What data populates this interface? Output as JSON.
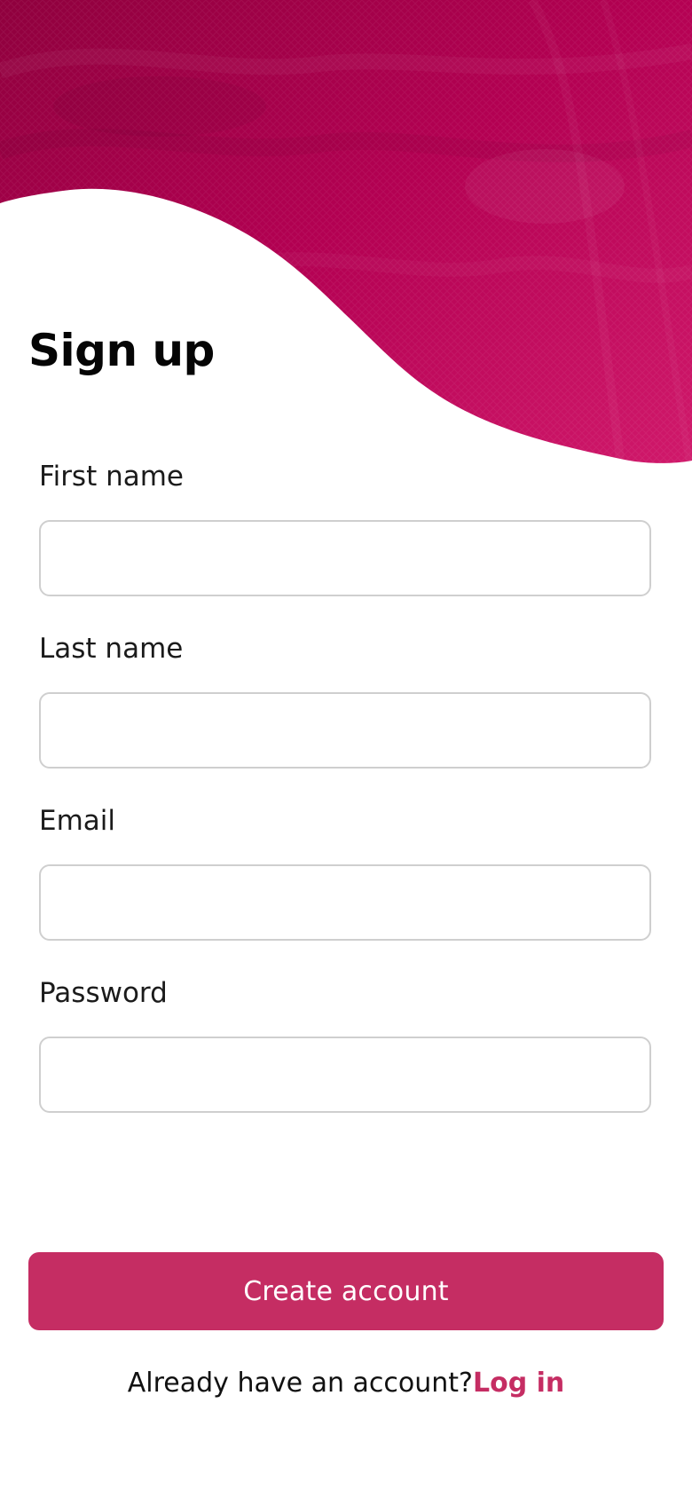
{
  "header": {
    "image": "crimson-fabric-texture-with-wave-edge",
    "colors": {
      "base": "#b30052",
      "dark": "#8f003d",
      "light": "#d1196b"
    }
  },
  "title": "Sign up",
  "fields": [
    {
      "label": "First name",
      "value": "",
      "placeholder": ""
    },
    {
      "label": "Last name",
      "value": "",
      "placeholder": ""
    },
    {
      "label": "Email",
      "value": "",
      "placeholder": ""
    },
    {
      "label": "Password",
      "value": "",
      "placeholder": ""
    }
  ],
  "cta": {
    "label": "Create account",
    "color": "#c52d63"
  },
  "footer": {
    "prompt": "Already have an account?",
    "link": "Log in",
    "link_color": "#c52d63"
  }
}
